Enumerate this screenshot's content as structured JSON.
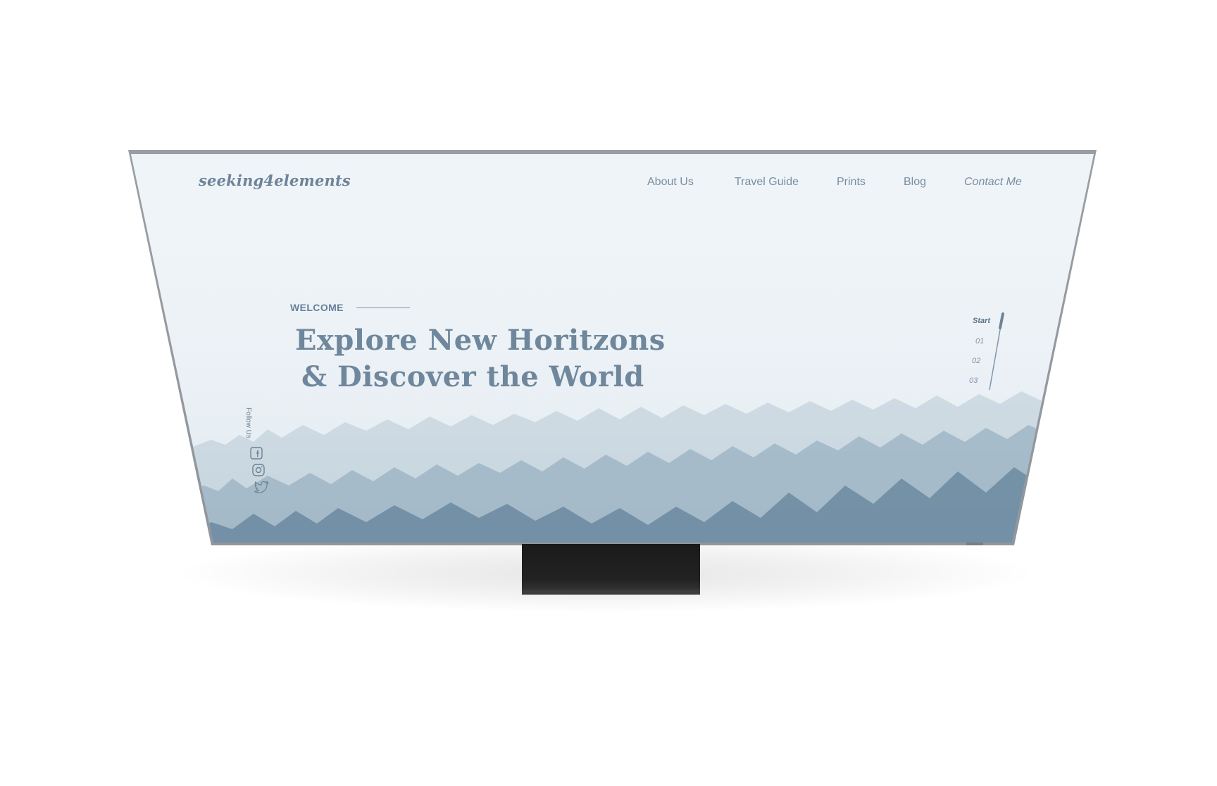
{
  "site": {
    "logo": "seeking4elements"
  },
  "nav": {
    "items": [
      {
        "label": "About Us"
      },
      {
        "label": "Travel Guide"
      },
      {
        "label": "Prints"
      },
      {
        "label": "Blog"
      },
      {
        "label": "Contact Me"
      }
    ]
  },
  "hero": {
    "eyebrow": "WELCOME",
    "headline_line1": "Explore New Horitzons",
    "headline_line2": "& Discover the World"
  },
  "social": {
    "label": "Follow Us",
    "icons": [
      "facebook-icon",
      "instagram-icon",
      "twitter-icon"
    ]
  },
  "steps": {
    "items": [
      "Start",
      "01",
      "02",
      "03"
    ],
    "active": "Start"
  },
  "colors": {
    "text_primary": "#6f879c",
    "nav_text": "#7a8da0",
    "stand": "#1a1a1a",
    "bezel": "#9da2a7"
  }
}
